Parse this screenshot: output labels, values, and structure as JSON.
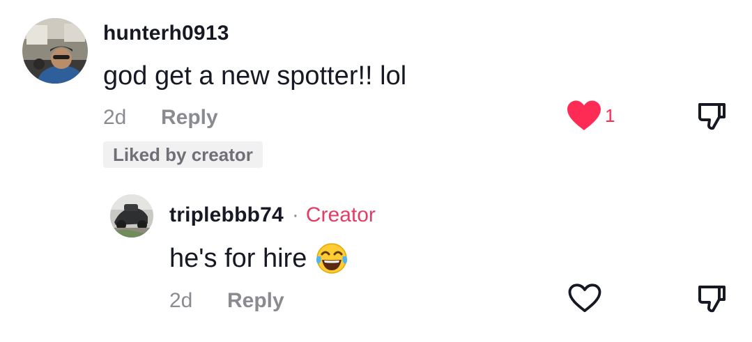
{
  "comments": [
    {
      "username": "hunterh0913",
      "text": "god get a new spotter!! lol",
      "age": "2d",
      "reply_label": "Reply",
      "like_count": "1",
      "liked": true,
      "badge": "Liked by creator"
    }
  ],
  "replies": [
    {
      "username": "triplebbb74",
      "separator": "·",
      "role_tag": "Creator",
      "text": "he's for hire",
      "emoji": "face-with-tears-of-joy",
      "age": "2d",
      "reply_label": "Reply",
      "liked": false
    }
  ],
  "colors": {
    "like_active": "#fe2c55",
    "creator_tag": "#e23e65",
    "muted_text": "#8a8b91",
    "primary_text": "#161823",
    "badge_bg": "#f1f1f2"
  }
}
